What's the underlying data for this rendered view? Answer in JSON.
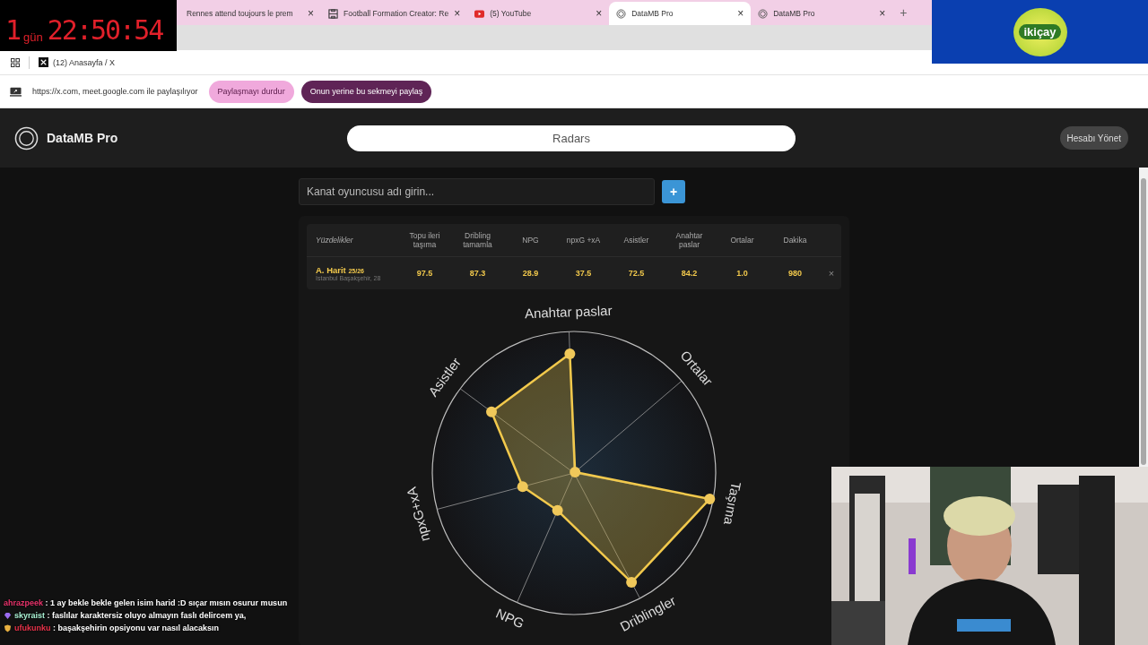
{
  "stream_overlay": {
    "timer": {
      "days": "1",
      "unit": "gün",
      "time": "22:50:54"
    },
    "sponsor": {
      "name": "ikiçay"
    },
    "chat": [
      {
        "user": "ahrazpeek",
        "color": "#e8336b",
        "kind": "plain",
        "message": ": 1 ay bekle bekle gelen isim harid :D sıçar mısın osurur musun"
      },
      {
        "user": "skyraist",
        "color": "#a8f0d2",
        "kind": "gem",
        "message": ": faslılar karaktersiz oluyo almayın faslı delircem ya,"
      },
      {
        "user": "ufukunku",
        "color": "#e8334a",
        "kind": "shield",
        "message": ": başakşehirin opsiyonu var nasıl alacaksın"
      }
    ]
  },
  "browser": {
    "tabs": [
      {
        "title": "Rennes attend toujours le prem",
        "kind": "plain",
        "close": "×",
        "selected": false
      },
      {
        "title": "Football Formation Creator: Re",
        "kind": "formation",
        "close": "×",
        "selected": false
      },
      {
        "title": "(5) YouTube",
        "kind": "video",
        "close": "×",
        "selected": false
      },
      {
        "title": "DataMB Pro",
        "kind": "site",
        "close": "×",
        "selected": true
      },
      {
        "title": "DataMB Pro",
        "kind": "site",
        "close": "×",
        "selected": false
      }
    ],
    "new_tab": "+",
    "bookmarks": [
      {
        "label": "(12) Anasayfa / X"
      }
    ],
    "share_bar": {
      "message": "https://x.com, meet.google.com ile paylaşılıyor",
      "buttons": [
        {
          "label": "Paylaşmayı durdur",
          "kind": "light"
        },
        {
          "label": "Onun yerine bu sekmeyi paylaş",
          "kind": "dark"
        }
      ]
    }
  },
  "app": {
    "brand": "DataMB Pro",
    "title": "Radars",
    "account_button": "Hesabı Yönet",
    "search": {
      "placeholder": "Kanat oyuncusu adı girin...",
      "add_button": "+"
    },
    "table": {
      "columns": [
        "Yüzdelikler",
        "Topu ileri taşıma",
        "Dribling tamamla",
        "NPG",
        "npxG +xA",
        "Asistler",
        "Anahtar paslar",
        "Ortalar",
        "Dakika"
      ],
      "rows": [
        {
          "name": "A. Harit",
          "season": "25/26",
          "club": "İstanbul Başakşehir, 28",
          "values": [
            "97.5",
            "87.3",
            "28.9",
            "37.5",
            "72.5",
            "84.2",
            "1.0",
            "980"
          ],
          "remove": "×"
        }
      ]
    },
    "radar": {
      "axes": [
        "Anahtar paslar",
        "Ortalar",
        "Taşıma",
        "Driblingler",
        "NPG",
        "npxG+xA",
        "Asistler"
      ]
    }
  }
}
